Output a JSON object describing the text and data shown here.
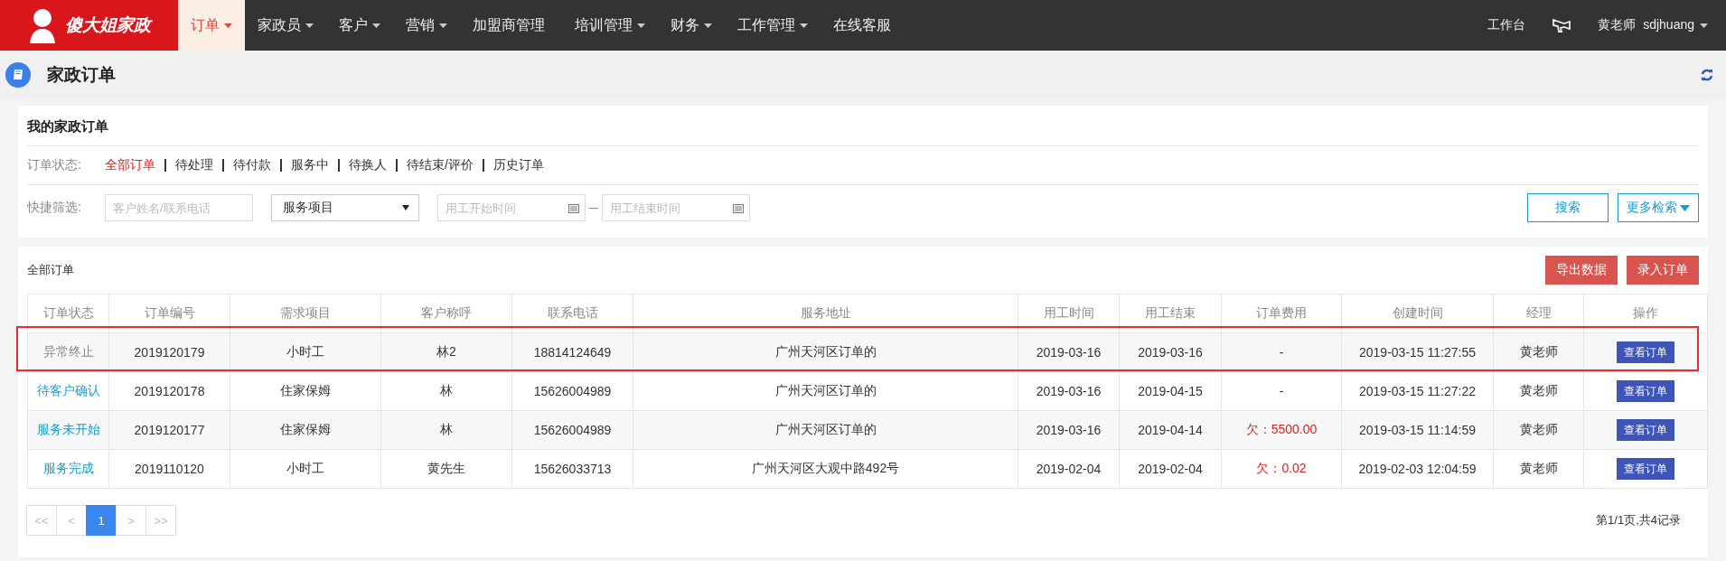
{
  "logo": {
    "text": "傻大姐家政"
  },
  "nav": [
    {
      "label": "订单",
      "dropdown": true,
      "selected": true
    },
    {
      "label": "家政员",
      "dropdown": true,
      "selected": false
    },
    {
      "label": "客户",
      "dropdown": true,
      "selected": false
    },
    {
      "label": "营销",
      "dropdown": true,
      "selected": false
    },
    {
      "label": "加盟商管理",
      "dropdown": false,
      "selected": false
    },
    {
      "label": "培训管理",
      "dropdown": true,
      "selected": false
    },
    {
      "label": "财务",
      "dropdown": true,
      "selected": false
    },
    {
      "label": "工作管理",
      "dropdown": true,
      "selected": false
    },
    {
      "label": "在线客服",
      "dropdown": false,
      "selected": false
    }
  ],
  "user_bar": {
    "workbench": "工作台",
    "user_name": "黄老师",
    "user_id": "sdjhuang"
  },
  "page_title": "家政订单",
  "filter_card": {
    "title": "我的家政订单",
    "status_label": "订单状态:",
    "status_tabs": [
      {
        "label": "全部订单",
        "selected": true
      },
      {
        "label": "待处理",
        "selected": false
      },
      {
        "label": "待付款",
        "selected": false
      },
      {
        "label": "服务中",
        "selected": false
      },
      {
        "label": "待换人",
        "selected": false
      },
      {
        "label": "待结束/评价",
        "selected": false
      },
      {
        "label": "历史订单",
        "selected": false
      }
    ],
    "quick_label": "快捷筛选:",
    "search": {
      "placeholder": "客户姓名/联系电话"
    },
    "service_select": {
      "value": "服务项目"
    },
    "start_date": {
      "placeholder": "用工开始时间"
    },
    "end_date": {
      "placeholder": "用工结束时间"
    },
    "buttons": [
      "搜索",
      "更多检索"
    ]
  },
  "orders": {
    "title": "全部订单",
    "buttons": [
      "导出数据",
      "录入订单"
    ],
    "columns": [
      "订单状态",
      "订单编号",
      "需求项目",
      "客户称呼",
      "联系电话",
      "服务地址",
      "用工时间",
      "用工结束",
      "订单费用",
      "创建时间",
      "经理",
      "操作"
    ],
    "rows": [
      {
        "status": {
          "text": "异常终止",
          "kind": "ended"
        },
        "id": "2019120179",
        "service": "小时工",
        "customer": "林2",
        "phone": "18814124649",
        "address": "广州天河区订单的",
        "start": "2019-03-16",
        "end": "2019-03-16",
        "fee": {
          "text": "-",
          "kind": "none"
        },
        "created": "2019-03-15 11:27:55",
        "manager": "黄老师",
        "action": "查看订单",
        "highlighted": true
      },
      {
        "status": {
          "text": "待客户确认",
          "kind": "active"
        },
        "id": "2019120178",
        "service": "住家保姆",
        "customer": "林",
        "phone": "15626004989",
        "address": "广州天河区订单的",
        "start": "2019-03-16",
        "end": "2019-04-15",
        "fee": {
          "text": "-",
          "kind": "none"
        },
        "created": "2019-03-15 11:27:22",
        "manager": "黄老师",
        "action": "查看订单",
        "highlighted": false
      },
      {
        "status": {
          "text": "服务未开始",
          "kind": "active"
        },
        "id": "2019120177",
        "service": "住家保姆",
        "customer": "林",
        "phone": "15626004989",
        "address": "广州天河区订单的",
        "start": "2019-03-16",
        "end": "2019-04-14",
        "fee": {
          "text": "欠：5500.00",
          "kind": "owed"
        },
        "created": "2019-03-15 11:14:59",
        "manager": "黄老师",
        "action": "查看订单",
        "highlighted": false
      },
      {
        "status": {
          "text": "服务完成",
          "kind": "active"
        },
        "id": "2019110120",
        "service": "小时工",
        "customer": "黄先生",
        "phone": "15626033713",
        "address": "广州天河区大观中路492号",
        "start": "2019-02-04",
        "end": "2019-02-04",
        "fee": {
          "text": "欠：0.02",
          "kind": "owed"
        },
        "created": "2019-02-03 12:04:59",
        "manager": "黄老师",
        "action": "查看订单",
        "highlighted": false
      }
    ],
    "pagination": [
      {
        "label": "<<",
        "selected": false
      },
      {
        "label": "<",
        "selected": false
      },
      {
        "label": "1",
        "selected": true
      },
      {
        "label": ">",
        "selected": false
      },
      {
        "label": ">>",
        "selected": false
      }
    ],
    "page_info": "第1/1页,共4记录"
  }
}
